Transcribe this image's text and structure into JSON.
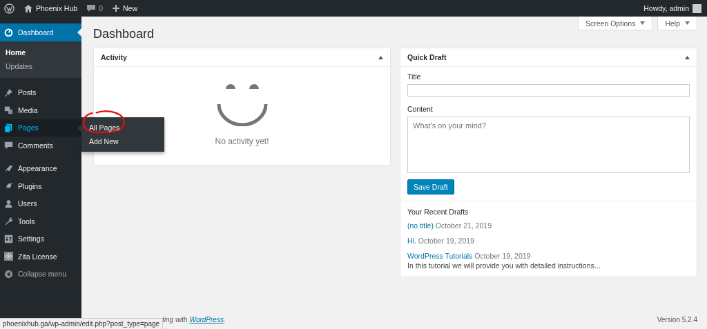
{
  "admin_bar": {
    "site_name": "Phoenix Hub",
    "comments_count": "0",
    "new_label": "New",
    "greeting": "Howdy, admin"
  },
  "sidebar": {
    "items": [
      {
        "label": "Dashboard",
        "selected": true,
        "highlighted": false,
        "children": [
          {
            "label": "Home",
            "selected": true
          },
          {
            "label": "Updates",
            "selected": false
          }
        ]
      },
      {
        "label": "Posts",
        "selected": false,
        "highlighted": false
      },
      {
        "label": "Media",
        "selected": false,
        "highlighted": false
      },
      {
        "label": "Pages",
        "selected": false,
        "highlighted": true,
        "flyout": [
          {
            "label": "All Pages"
          },
          {
            "label": "Add New"
          }
        ]
      },
      {
        "label": "Comments",
        "selected": false,
        "highlighted": false
      },
      {
        "label": "Appearance",
        "selected": false,
        "highlighted": false,
        "group_start": true
      },
      {
        "label": "Plugins",
        "selected": false,
        "highlighted": false
      },
      {
        "label": "Users",
        "selected": false,
        "highlighted": false
      },
      {
        "label": "Tools",
        "selected": false,
        "highlighted": false
      },
      {
        "label": "Settings",
        "selected": false,
        "highlighted": false
      },
      {
        "label": "Zita License",
        "selected": false,
        "highlighted": false
      }
    ],
    "collapse_label": "Collapse menu"
  },
  "page_title": "Dashboard",
  "top_buttons": [
    "Screen Options",
    "Help"
  ],
  "activity": {
    "title": "Activity",
    "empty_message": "No activity yet!"
  },
  "quick_draft": {
    "title": "Quick Draft",
    "title_label": "Title",
    "content_label": "Content",
    "content_placeholder": "What's on your mind?",
    "save_button": "Save Draft",
    "recent_heading": "Your Recent Drafts",
    "drafts": [
      {
        "title": "(no title)",
        "date": "October 21, 2019"
      },
      {
        "title": "Hi.",
        "date": "October 19, 2019"
      },
      {
        "title": "WordPress Tutorials",
        "date": "October 19, 2019",
        "excerpt": "In this tutorial we will provide you with detailed instructions..."
      }
    ]
  },
  "footer": {
    "text": "ting with",
    "link": "WordPress",
    "end": ".",
    "version": "Version 5.2.4"
  },
  "status_url": "phoenixhub.ga/wp-admin/edit.php?post_type=page"
}
